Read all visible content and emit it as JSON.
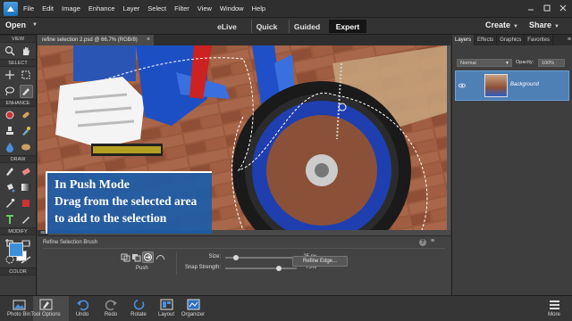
{
  "menubar": {
    "items": [
      "File",
      "Edit",
      "Image",
      "Enhance",
      "Layer",
      "Select",
      "Filter",
      "View",
      "Window",
      "Help"
    ]
  },
  "modebar": {
    "open_label": "Open",
    "tabs": [
      "eLive",
      "Quick",
      "Guided",
      "Expert"
    ],
    "active_tab": "Expert",
    "create_label": "Create",
    "share_label": "Share"
  },
  "toolbox": {
    "sections": [
      "VIEW",
      "SELECT",
      "ENHANCE",
      "DRAW",
      "MODIFY",
      "COLOR"
    ],
    "foreground_color": "#3d8fd9",
    "background_color": "#ffffff"
  },
  "document": {
    "tab_title": "refine selection 2.psd @ 66.7% (RGB/8)",
    "close_glyph": "×",
    "zoom_readout": "66"
  },
  "caption": {
    "title": "In Push Mode",
    "body": "Drag from the selected area to add to the selection"
  },
  "tool_options": {
    "title": "Refine Selection Brush",
    "mode_label": "Push",
    "size_label": "Size:",
    "size_value": "25 px",
    "size_fraction": 0.15,
    "snap_label": "Snap Strength:",
    "snap_value": "75%",
    "snap_fraction": 0.75,
    "refine_edge_label": "Refine Edge..."
  },
  "right_panel": {
    "tabs": [
      "Layers",
      "Effects",
      "Graphics",
      "Favorites"
    ],
    "active_tab": "Layers",
    "blend_mode": "Normal",
    "opacity_label": "Opacity:",
    "opacity_value": "100%",
    "layer_name": "Background"
  },
  "taskbar": {
    "photo_bin": "Photo Bin",
    "tool_options": "Tool Options",
    "undo": "Undo",
    "redo": "Redo",
    "rotate": "Rotate",
    "layout": "Layout",
    "organizer": "Organizer",
    "more": "More"
  }
}
